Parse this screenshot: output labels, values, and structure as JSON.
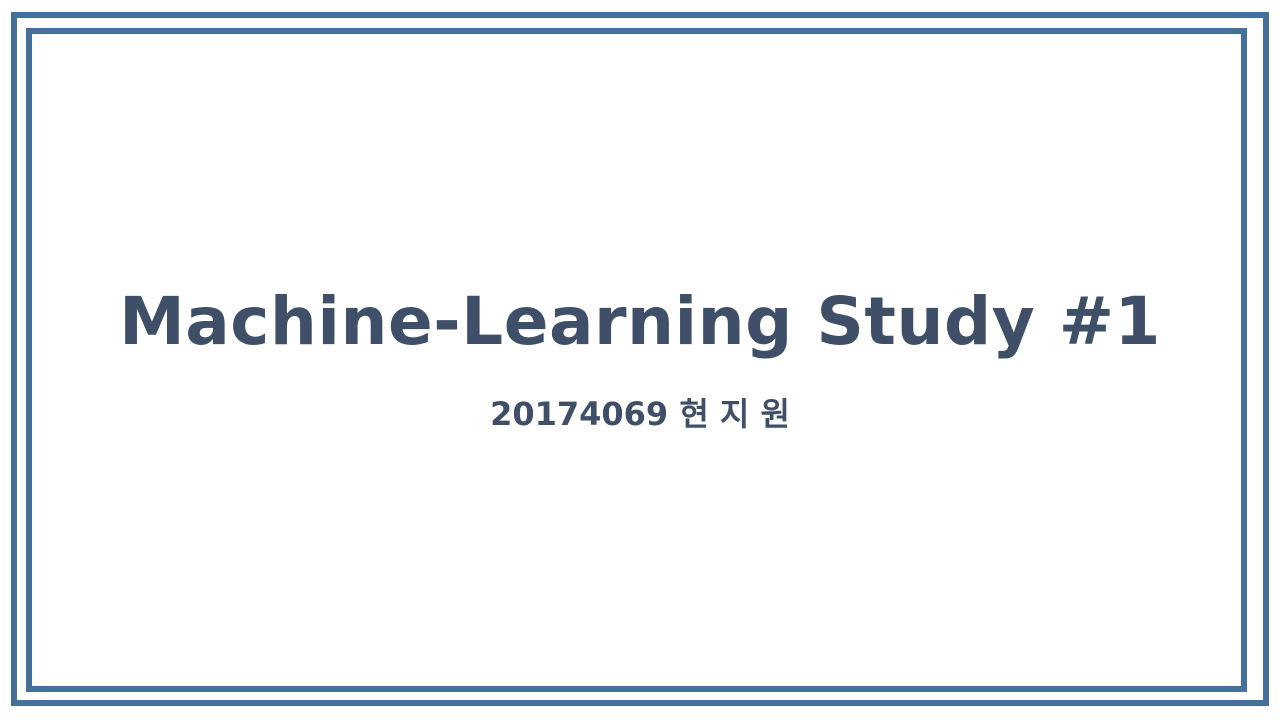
{
  "slide": {
    "title": "Machine-Learning Study #1",
    "subtitle": "20174069 현 지 원"
  },
  "colors": {
    "border": "#44709c",
    "text": "#3f4f68",
    "background": "#ffffff"
  }
}
